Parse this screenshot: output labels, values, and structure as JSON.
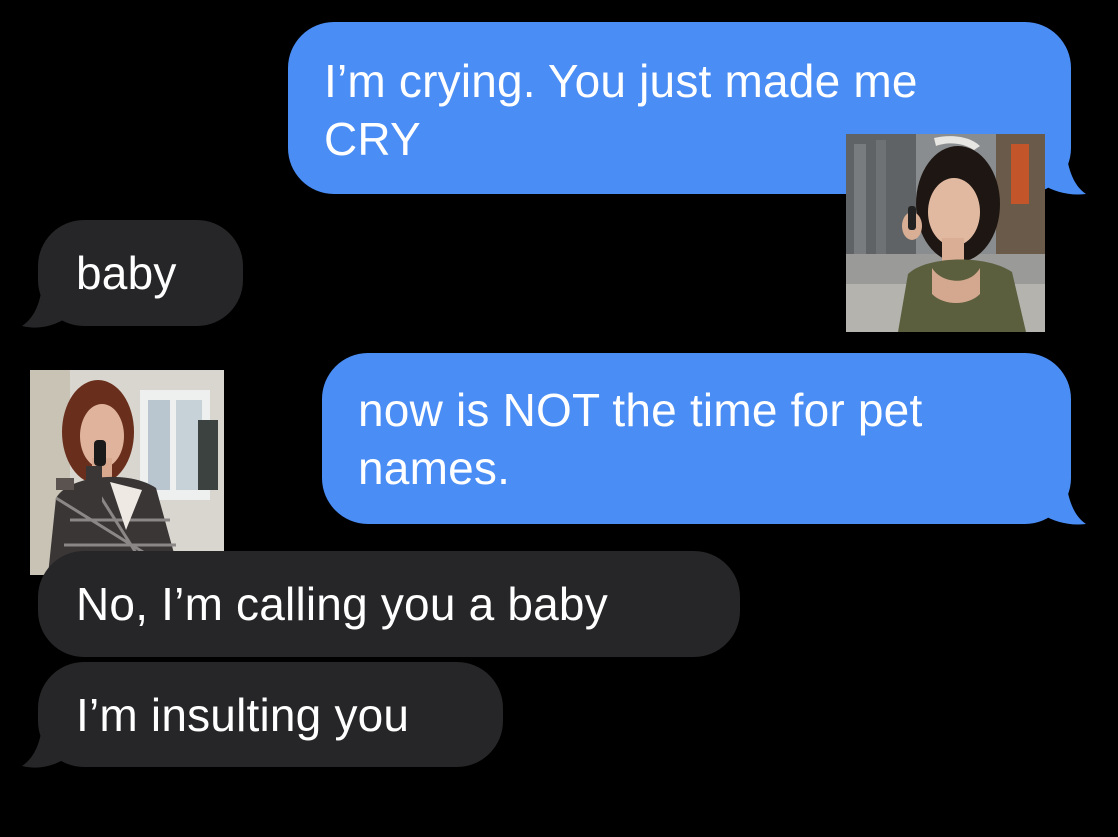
{
  "conversation": {
    "messages": [
      {
        "sender": "me",
        "text": "I’m crying. You just made me CRY"
      },
      {
        "sender": "them",
        "text": "baby"
      },
      {
        "sender": "me",
        "text": "now is NOT the time for pet names."
      },
      {
        "sender": "them",
        "text": "No, I’m calling you a baby"
      },
      {
        "sender": "them",
        "text": "I’m insulting you"
      }
    ],
    "stickers": [
      {
        "icon": "woman-on-phone-street-photo"
      },
      {
        "icon": "woman-on-phone-office-photo"
      }
    ]
  },
  "colors": {
    "background": "#000000",
    "sent_bubble": "#4a8df5",
    "received_bubble": "#262628",
    "text": "#ffffff"
  }
}
